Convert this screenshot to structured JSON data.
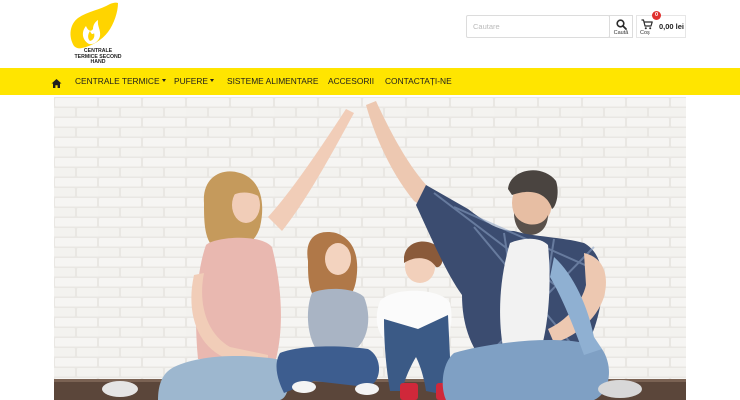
{
  "logo": {
    "text": "CENTRALE TERMICE SECOND HAND",
    "icon": "flame-icon",
    "color": "#ffd400"
  },
  "search": {
    "placeholder": "Cautare",
    "button_label": "Caută",
    "icon": "search-icon"
  },
  "cart": {
    "label": "Coș",
    "count": "0",
    "total": "0,00 lei",
    "icon": "cart-icon"
  },
  "nav": {
    "home_icon": "home-icon",
    "items": [
      {
        "label": "CENTRALE TERMICE",
        "dropdown": true
      },
      {
        "label": "PUFERE",
        "dropdown": true
      },
      {
        "label": "SISTEME ALIMENTARE",
        "dropdown": false
      },
      {
        "label": "ACCESORII",
        "dropdown": false
      },
      {
        "label": "CONTACTAȚI-NE",
        "dropdown": false
      }
    ]
  },
  "hero": {
    "image": "family-under-roof-hands-photo"
  },
  "colors": {
    "accent": "#ffe500",
    "badge": "#e0312f",
    "text": "#1e1e1e"
  }
}
